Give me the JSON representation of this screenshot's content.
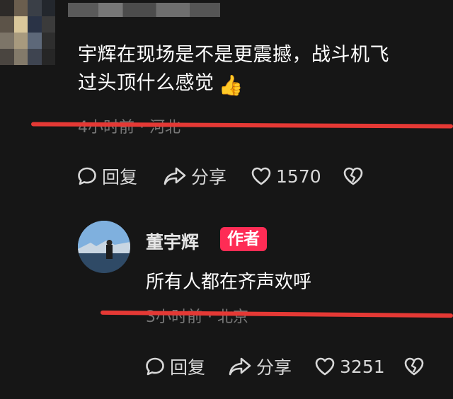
{
  "colors": {
    "background": "#161616",
    "highlight": "#e53935",
    "badge": "#fe2c55",
    "muted": "#777777"
  },
  "comment": {
    "text_line1": "宇辉在现场是不是更震撼，战斗机飞",
    "text_line2": "过头顶什么感觉",
    "emoji": "👍",
    "time_location": "4小时前 · 河北",
    "actions": {
      "reply": "回复",
      "share": "分享",
      "likes": "1570"
    },
    "icons": [
      "reply-icon",
      "share-icon",
      "heart-icon",
      "broken-heart-icon"
    ]
  },
  "reply": {
    "username": "董宇辉",
    "badge": "作者",
    "text": "所有人都在齐声欢呼",
    "time_location": "3小时前 · 北京",
    "actions": {
      "reply": "回复",
      "share": "分享",
      "likes": "3251"
    }
  }
}
